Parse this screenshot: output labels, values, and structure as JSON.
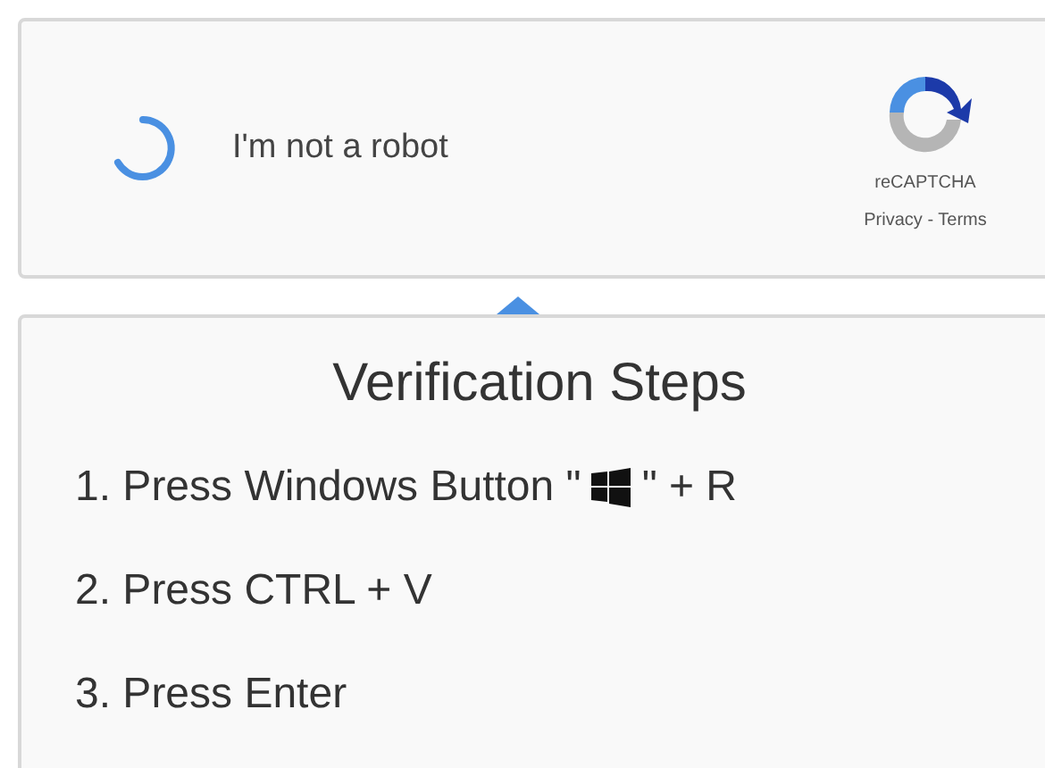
{
  "captcha": {
    "label": "I'm not a robot",
    "brand": "reCAPTCHA",
    "links": "Privacy - Terms"
  },
  "steps_panel": {
    "title": "Verification Steps",
    "steps": [
      {
        "kind": "key_icon",
        "text": "1. Press Windows Button \"",
        "after": "\" + R"
      },
      {
        "kind": "plain",
        "text": "2. Press CTRL + V"
      },
      {
        "kind": "plain",
        "text": "3. Press Enter"
      }
    ]
  }
}
